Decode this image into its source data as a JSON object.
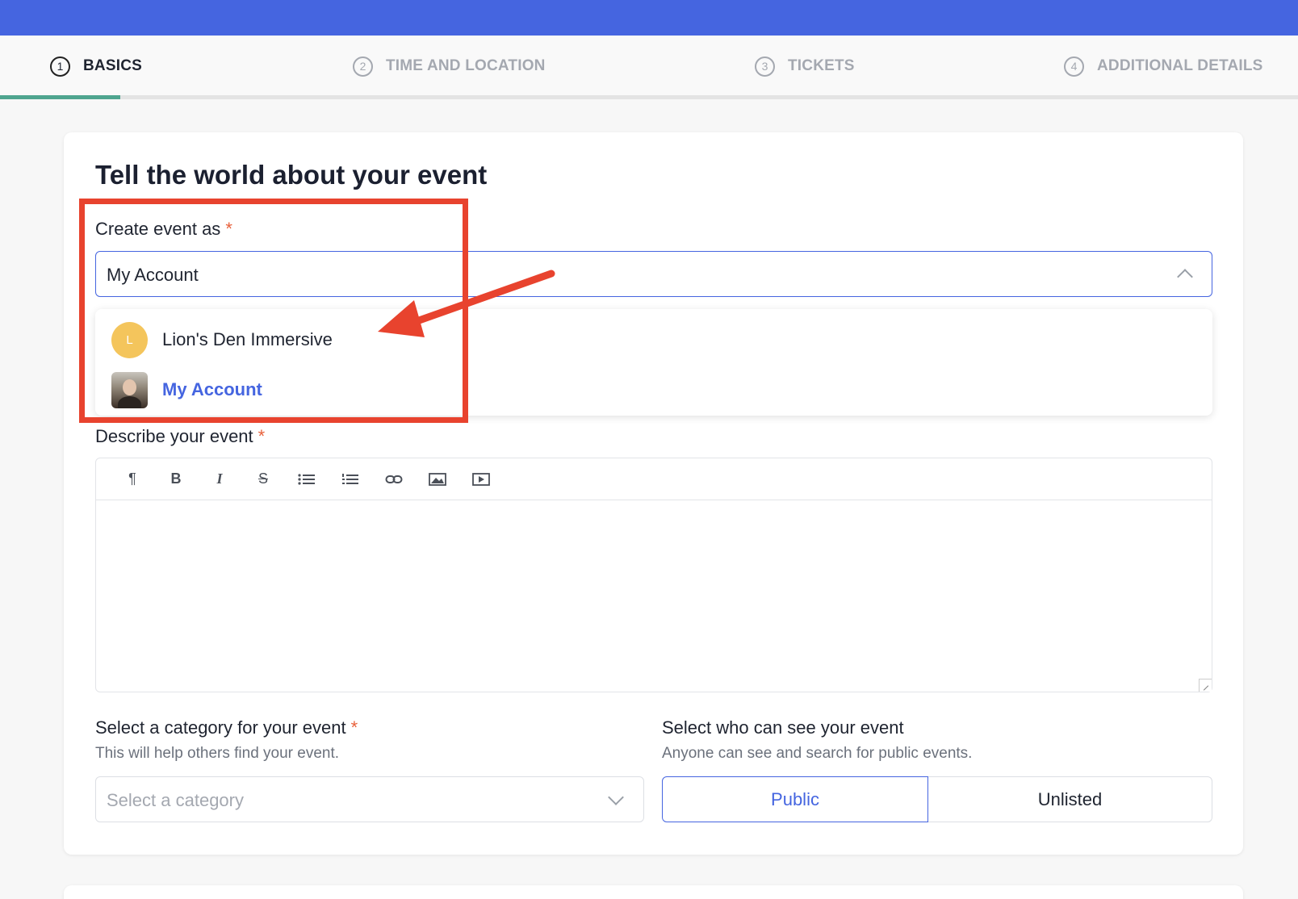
{
  "steps": [
    {
      "num": "1",
      "label": "BASICS"
    },
    {
      "num": "2",
      "label": "TIME AND LOCATION"
    },
    {
      "num": "3",
      "label": "TICKETS"
    },
    {
      "num": "4",
      "label": "ADDITIONAL DETAILS"
    }
  ],
  "form": {
    "heading": "Tell the world about your event",
    "create_as": {
      "label": "Create event as",
      "required": "*",
      "value": "My Account",
      "options": [
        {
          "avatar_letter": "L",
          "name": "Lion's Den Immersive"
        },
        {
          "name": "My Account",
          "selected": true
        }
      ]
    },
    "describe": {
      "label": "Describe your event",
      "required": "*",
      "toolbar": [
        {
          "icon": "paragraph-icon",
          "glyph": "¶"
        },
        {
          "icon": "bold-icon",
          "glyph": "B"
        },
        {
          "icon": "italic-icon",
          "glyph": "I"
        },
        {
          "icon": "strikethrough-icon",
          "glyph": "S"
        },
        {
          "icon": "bullet-list-icon"
        },
        {
          "icon": "numbered-list-icon"
        },
        {
          "icon": "link-icon"
        },
        {
          "icon": "image-icon"
        },
        {
          "icon": "video-icon"
        }
      ]
    },
    "category": {
      "label": "Select a category for your event",
      "required": "*",
      "hint": "This will help others find your event.",
      "placeholder": "Select a category"
    },
    "visibility": {
      "label": "Select who can see your event",
      "hint": "Anyone can see and search for public events.",
      "options": [
        "Public",
        "Unlisted"
      ],
      "selected": "Public"
    }
  },
  "colors": {
    "brand": "#4565e0",
    "progress": "#4fa58f",
    "required": "#e8613c",
    "annotation": "#e8432e"
  }
}
